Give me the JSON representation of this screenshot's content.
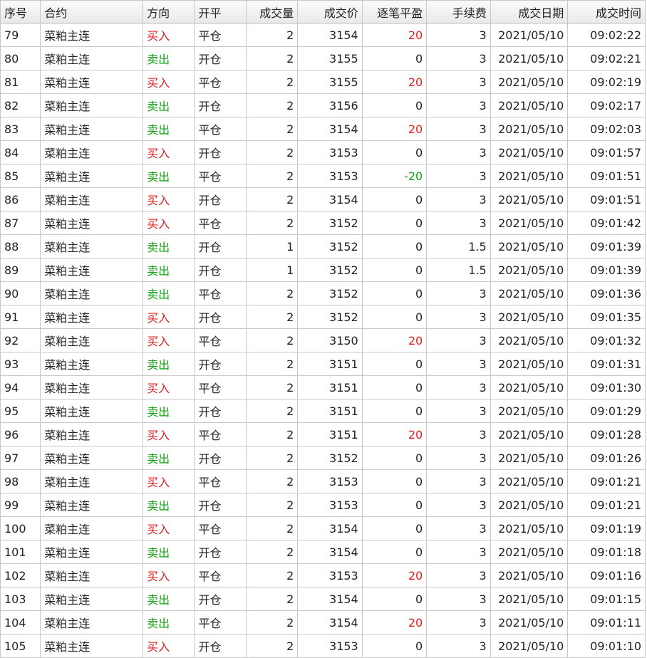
{
  "colors": {
    "buy": "#e02020",
    "sell": "#18a018",
    "profit": "#e02020",
    "loss": "#18a018"
  },
  "headers": [
    "序号",
    "合约",
    "方向",
    "开平",
    "成交量",
    "成交价",
    "逐笔平盈",
    "手续费",
    "成交日期",
    "成交时间"
  ],
  "rows": [
    {
      "seq": "79",
      "contract": "菜粕主连",
      "direction": "买入",
      "offset": "平仓",
      "qty": "2",
      "price": "3154",
      "pnl": "20",
      "fee": "3",
      "date": "2021/05/10",
      "time": "09:02:22"
    },
    {
      "seq": "80",
      "contract": "菜粕主连",
      "direction": "卖出",
      "offset": "开仓",
      "qty": "2",
      "price": "3155",
      "pnl": "0",
      "fee": "3",
      "date": "2021/05/10",
      "time": "09:02:21"
    },
    {
      "seq": "81",
      "contract": "菜粕主连",
      "direction": "买入",
      "offset": "平仓",
      "qty": "2",
      "price": "3155",
      "pnl": "20",
      "fee": "3",
      "date": "2021/05/10",
      "time": "09:02:19"
    },
    {
      "seq": "82",
      "contract": "菜粕主连",
      "direction": "卖出",
      "offset": "开仓",
      "qty": "2",
      "price": "3156",
      "pnl": "0",
      "fee": "3",
      "date": "2021/05/10",
      "time": "09:02:17"
    },
    {
      "seq": "83",
      "contract": "菜粕主连",
      "direction": "卖出",
      "offset": "平仓",
      "qty": "2",
      "price": "3154",
      "pnl": "20",
      "fee": "3",
      "date": "2021/05/10",
      "time": "09:02:03"
    },
    {
      "seq": "84",
      "contract": "菜粕主连",
      "direction": "买入",
      "offset": "开仓",
      "qty": "2",
      "price": "3153",
      "pnl": "0",
      "fee": "3",
      "date": "2021/05/10",
      "time": "09:01:57"
    },
    {
      "seq": "85",
      "contract": "菜粕主连",
      "direction": "卖出",
      "offset": "平仓",
      "qty": "2",
      "price": "3153",
      "pnl": "-20",
      "fee": "3",
      "date": "2021/05/10",
      "time": "09:01:51"
    },
    {
      "seq": "86",
      "contract": "菜粕主连",
      "direction": "买入",
      "offset": "开仓",
      "qty": "2",
      "price": "3154",
      "pnl": "0",
      "fee": "3",
      "date": "2021/05/10",
      "time": "09:01:51"
    },
    {
      "seq": "87",
      "contract": "菜粕主连",
      "direction": "买入",
      "offset": "平仓",
      "qty": "2",
      "price": "3152",
      "pnl": "0",
      "fee": "3",
      "date": "2021/05/10",
      "time": "09:01:42"
    },
    {
      "seq": "88",
      "contract": "菜粕主连",
      "direction": "卖出",
      "offset": "开仓",
      "qty": "1",
      "price": "3152",
      "pnl": "0",
      "fee": "1.5",
      "date": "2021/05/10",
      "time": "09:01:39"
    },
    {
      "seq": "89",
      "contract": "菜粕主连",
      "direction": "卖出",
      "offset": "开仓",
      "qty": "1",
      "price": "3152",
      "pnl": "0",
      "fee": "1.5",
      "date": "2021/05/10",
      "time": "09:01:39"
    },
    {
      "seq": "90",
      "contract": "菜粕主连",
      "direction": "卖出",
      "offset": "平仓",
      "qty": "2",
      "price": "3152",
      "pnl": "0",
      "fee": "3",
      "date": "2021/05/10",
      "time": "09:01:36"
    },
    {
      "seq": "91",
      "contract": "菜粕主连",
      "direction": "买入",
      "offset": "开仓",
      "qty": "2",
      "price": "3152",
      "pnl": "0",
      "fee": "3",
      "date": "2021/05/10",
      "time": "09:01:35"
    },
    {
      "seq": "92",
      "contract": "菜粕主连",
      "direction": "买入",
      "offset": "平仓",
      "qty": "2",
      "price": "3150",
      "pnl": "20",
      "fee": "3",
      "date": "2021/05/10",
      "time": "09:01:32"
    },
    {
      "seq": "93",
      "contract": "菜粕主连",
      "direction": "卖出",
      "offset": "开仓",
      "qty": "2",
      "price": "3151",
      "pnl": "0",
      "fee": "3",
      "date": "2021/05/10",
      "time": "09:01:31"
    },
    {
      "seq": "94",
      "contract": "菜粕主连",
      "direction": "买入",
      "offset": "平仓",
      "qty": "2",
      "price": "3151",
      "pnl": "0",
      "fee": "3",
      "date": "2021/05/10",
      "time": "09:01:30"
    },
    {
      "seq": "95",
      "contract": "菜粕主连",
      "direction": "卖出",
      "offset": "开仓",
      "qty": "2",
      "price": "3151",
      "pnl": "0",
      "fee": "3",
      "date": "2021/05/10",
      "time": "09:01:29"
    },
    {
      "seq": "96",
      "contract": "菜粕主连",
      "direction": "买入",
      "offset": "平仓",
      "qty": "2",
      "price": "3151",
      "pnl": "20",
      "fee": "3",
      "date": "2021/05/10",
      "time": "09:01:28"
    },
    {
      "seq": "97",
      "contract": "菜粕主连",
      "direction": "卖出",
      "offset": "开仓",
      "qty": "2",
      "price": "3152",
      "pnl": "0",
      "fee": "3",
      "date": "2021/05/10",
      "time": "09:01:26"
    },
    {
      "seq": "98",
      "contract": "菜粕主连",
      "direction": "买入",
      "offset": "平仓",
      "qty": "2",
      "price": "3153",
      "pnl": "0",
      "fee": "3",
      "date": "2021/05/10",
      "time": "09:01:21"
    },
    {
      "seq": "99",
      "contract": "菜粕主连",
      "direction": "卖出",
      "offset": "开仓",
      "qty": "2",
      "price": "3153",
      "pnl": "0",
      "fee": "3",
      "date": "2021/05/10",
      "time": "09:01:21"
    },
    {
      "seq": "100",
      "contract": "菜粕主连",
      "direction": "买入",
      "offset": "平仓",
      "qty": "2",
      "price": "3154",
      "pnl": "0",
      "fee": "3",
      "date": "2021/05/10",
      "time": "09:01:19"
    },
    {
      "seq": "101",
      "contract": "菜粕主连",
      "direction": "卖出",
      "offset": "开仓",
      "qty": "2",
      "price": "3154",
      "pnl": "0",
      "fee": "3",
      "date": "2021/05/10",
      "time": "09:01:18"
    },
    {
      "seq": "102",
      "contract": "菜粕主连",
      "direction": "买入",
      "offset": "平仓",
      "qty": "2",
      "price": "3153",
      "pnl": "20",
      "fee": "3",
      "date": "2021/05/10",
      "time": "09:01:16"
    },
    {
      "seq": "103",
      "contract": "菜粕主连",
      "direction": "卖出",
      "offset": "开仓",
      "qty": "2",
      "price": "3154",
      "pnl": "0",
      "fee": "3",
      "date": "2021/05/10",
      "time": "09:01:15"
    },
    {
      "seq": "104",
      "contract": "菜粕主连",
      "direction": "卖出",
      "offset": "平仓",
      "qty": "2",
      "price": "3154",
      "pnl": "20",
      "fee": "3",
      "date": "2021/05/10",
      "time": "09:01:11"
    },
    {
      "seq": "105",
      "contract": "菜粕主连",
      "direction": "买入",
      "offset": "开仓",
      "qty": "2",
      "price": "3153",
      "pnl": "0",
      "fee": "3",
      "date": "2021/05/10",
      "time": "09:01:10"
    }
  ]
}
